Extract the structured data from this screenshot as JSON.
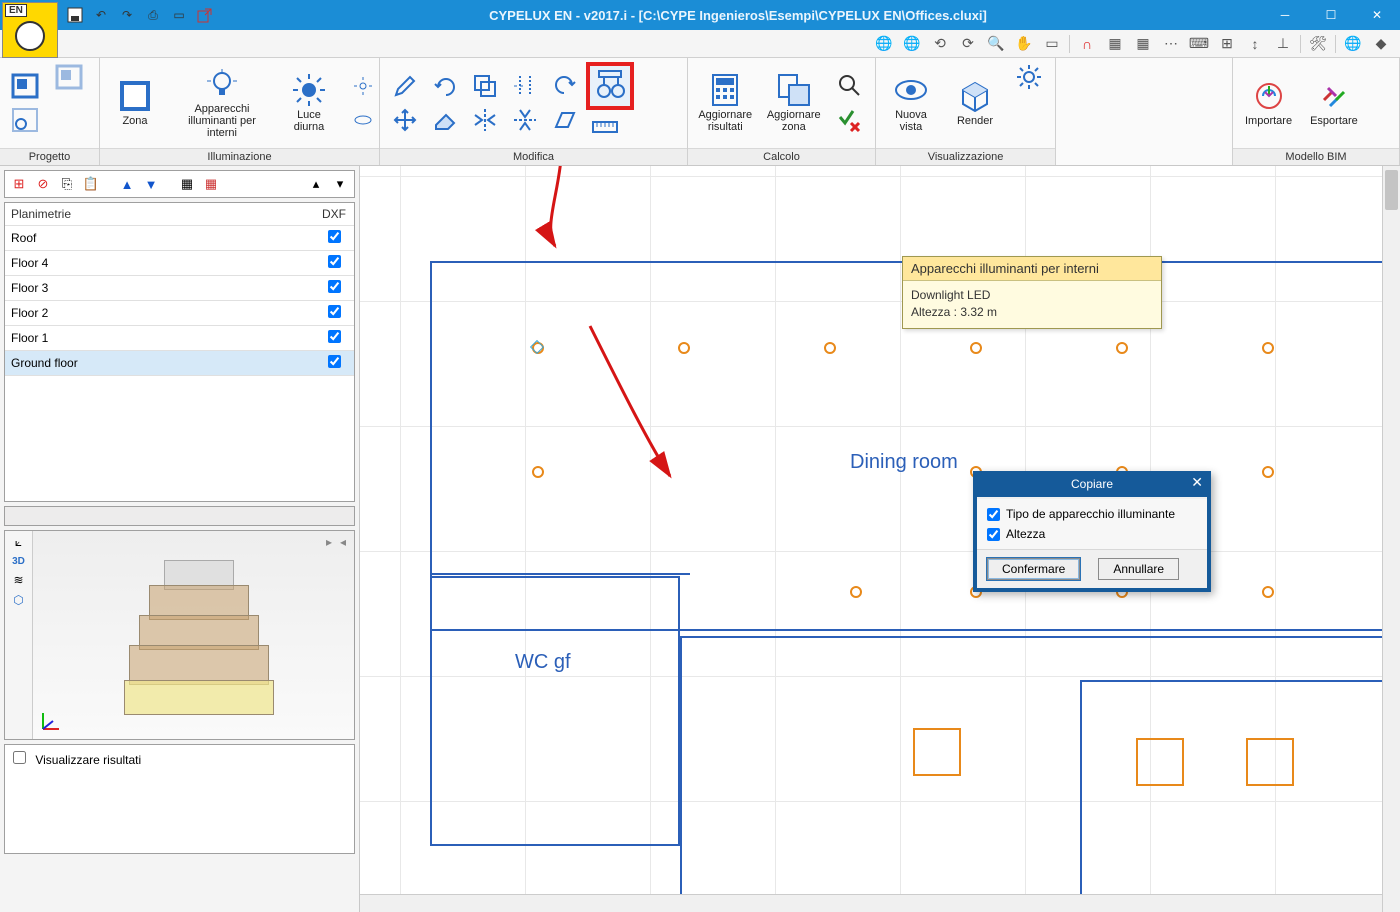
{
  "app": {
    "badge_text": "EN",
    "title": "CYPELUX EN - v2017.i - [C:\\CYPE Ingenieros\\Esempi\\CYPELUX EN\\Offices.cluxi]"
  },
  "ribbon": {
    "groups": {
      "progetto": "Progetto",
      "illuminazione": "Illuminazione",
      "modifica": "Modifica",
      "calcolo": "Calcolo",
      "visualizzazione": "Visualizzazione",
      "modello_bim": "Modello BIM"
    },
    "buttons": {
      "zona": "Zona",
      "apparecchi": "Apparecchi\nilluminanti per interni",
      "luce": "Luce\ndiurna",
      "aggiornare_ris": "Aggiornare\nrisultati",
      "aggiornare_zona": "Aggiornare\nzona",
      "nuova_vista": "Nuova\nvista",
      "render": "Render",
      "importare": "Importare",
      "esportare": "Esportare"
    }
  },
  "sidebar": {
    "header_plan": "Planimetrie",
    "header_dxf": "DXF",
    "floors": [
      {
        "name": "Roof",
        "dxf": true,
        "selected": false
      },
      {
        "name": "Floor 4",
        "dxf": true,
        "selected": false
      },
      {
        "name": "Floor 3",
        "dxf": true,
        "selected": false
      },
      {
        "name": "Floor 2",
        "dxf": true,
        "selected": false
      },
      {
        "name": "Floor 1",
        "dxf": true,
        "selected": false
      },
      {
        "name": "Ground floor",
        "dxf": true,
        "selected": true
      }
    ],
    "results_label": "Visualizzare risultati"
  },
  "canvas": {
    "labels": {
      "dining": "Dining room",
      "wc": "WC gf"
    }
  },
  "tooltip": {
    "title": "Apparecchi illuminanti per interni",
    "line1": "Downlight LED",
    "line2": "Altezza : 3.32 m"
  },
  "dialog": {
    "title": "Copiare",
    "opt1": "Tipo de apparecchio illuminante",
    "opt2": "Altezza",
    "confirm": "Confermare",
    "cancel": "Annullare"
  }
}
